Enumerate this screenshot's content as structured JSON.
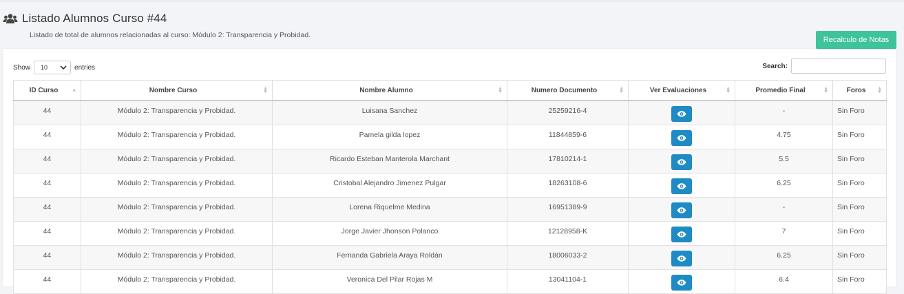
{
  "header": {
    "title": "Listado Alumnos Curso #44",
    "subtitle": "Listado de total de alumnos relacionadas al curso: Módulo 2: Transparencia y Probidad.",
    "recalc_label": "Recalculo de Notas",
    "icon": "users-icon"
  },
  "controls": {
    "show_label": "Show",
    "entries_value": "10",
    "entries_label": "entries",
    "search_label": "Search:",
    "search_value": ""
  },
  "table": {
    "columns": [
      "ID Curso",
      "Nombre Curso",
      "Nombre Alumno",
      "Numero Documento",
      "Ver Evaluaciones",
      "Promedio Final",
      "Foros"
    ],
    "rows": [
      {
        "id": "44",
        "curso": "Módulo 2: Transparencia y Probidad.",
        "alumno": "Luisana Sanchez",
        "doc": "25259216-4",
        "promedio": "-",
        "foros": "Sin Foro"
      },
      {
        "id": "44",
        "curso": "Módulo 2: Transparencia y Probidad.",
        "alumno": "Pamela gilda lopez",
        "doc": "11844859-6",
        "promedio": "4.75",
        "foros": "Sin Foro"
      },
      {
        "id": "44",
        "curso": "Módulo 2: Transparencia y Probidad.",
        "alumno": "Ricardo Esteban Manterola Marchant",
        "doc": "17810214-1",
        "promedio": "5.5",
        "foros": "Sin Foro"
      },
      {
        "id": "44",
        "curso": "Módulo 2: Transparencia y Probidad.",
        "alumno": "Cristobal Alejandro Jimenez Pulgar",
        "doc": "18263108-6",
        "promedio": "6.25",
        "foros": "Sin Foro"
      },
      {
        "id": "44",
        "curso": "Módulo 2: Transparencia y Probidad.",
        "alumno": "Lorena Riquelme Medina",
        "doc": "16951389-9",
        "promedio": "-",
        "foros": "Sin Foro"
      },
      {
        "id": "44",
        "curso": "Módulo 2: Transparencia y Probidad.",
        "alumno": "Jorge Javier Jhonson Polanco",
        "doc": "12128958-K",
        "promedio": "7",
        "foros": "Sin Foro"
      },
      {
        "id": "44",
        "curso": "Módulo 2: Transparencia y Probidad.",
        "alumno": "Fernanda Gabriela Araya Roldán",
        "doc": "18006033-2",
        "promedio": "6.25",
        "foros": "Sin Foro"
      },
      {
        "id": "44",
        "curso": "Módulo 2: Transparencia y Probidad.",
        "alumno": "Veronica Del Pilar Rojas M",
        "doc": "13041104-1",
        "promedio": "6.4",
        "foros": "Sin Foro"
      }
    ]
  },
  "colors": {
    "recalc_button": "#3ec39a",
    "eye_button": "#1f8bc4",
    "odd_row": "#f7f7f7"
  }
}
